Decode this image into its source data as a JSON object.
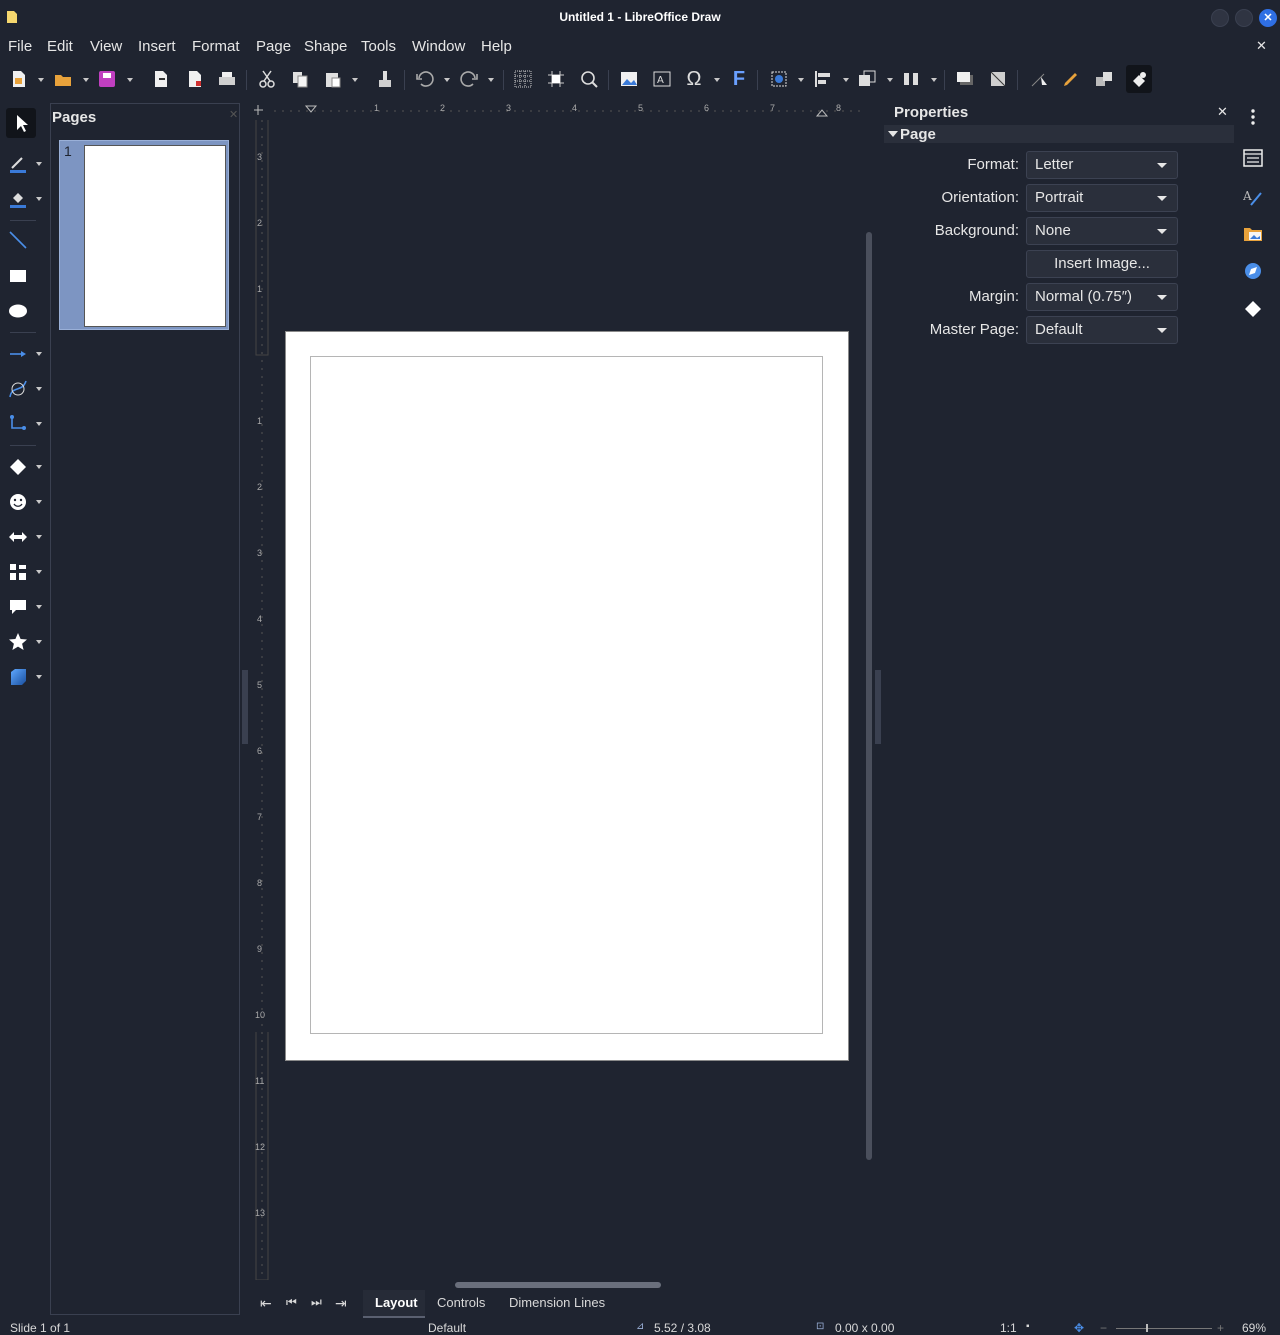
{
  "window": {
    "title": "Untitled 1 - LibreOffice Draw"
  },
  "menu": [
    "File",
    "Edit",
    "View",
    "Insert",
    "Format",
    "Page",
    "Shape",
    "Tools",
    "Window",
    "Help"
  ],
  "pages_panel": {
    "title": "Pages",
    "thumb_number": "1"
  },
  "properties": {
    "title": "Properties",
    "section": "Page",
    "format_label": "Format:",
    "format_value": "Letter",
    "orientation_label": "Orientation:",
    "orientation_value": "Portrait",
    "background_label": "Background:",
    "background_value": "None",
    "insert_image_label": "Insert Image...",
    "margin_label": "Margin:",
    "margin_value": "Normal (0.75″)",
    "master_page_label": "Master Page:",
    "master_page_value": "Default"
  },
  "ruler": {
    "h_ticks": [
      "1",
      "2",
      "3",
      "4",
      "5",
      "6",
      "7",
      "8"
    ],
    "v_ticks": [
      "3",
      "2",
      "1",
      "1",
      "2",
      "3",
      "4",
      "5",
      "6",
      "7",
      "8",
      "9",
      "10",
      "11",
      "12",
      "13"
    ]
  },
  "tabs": [
    "Layout",
    "Controls",
    "Dimension Lines"
  ],
  "status": {
    "slide": "Slide 1 of 1",
    "master": "Default",
    "position": "5.52 / 3.08",
    "size": "0.00 x 0.00",
    "scale": "1:1",
    "zoom": "69%"
  },
  "colors": {
    "accent": "#2f6fe4",
    "background": "#1f2430",
    "page": "#ffffff"
  }
}
